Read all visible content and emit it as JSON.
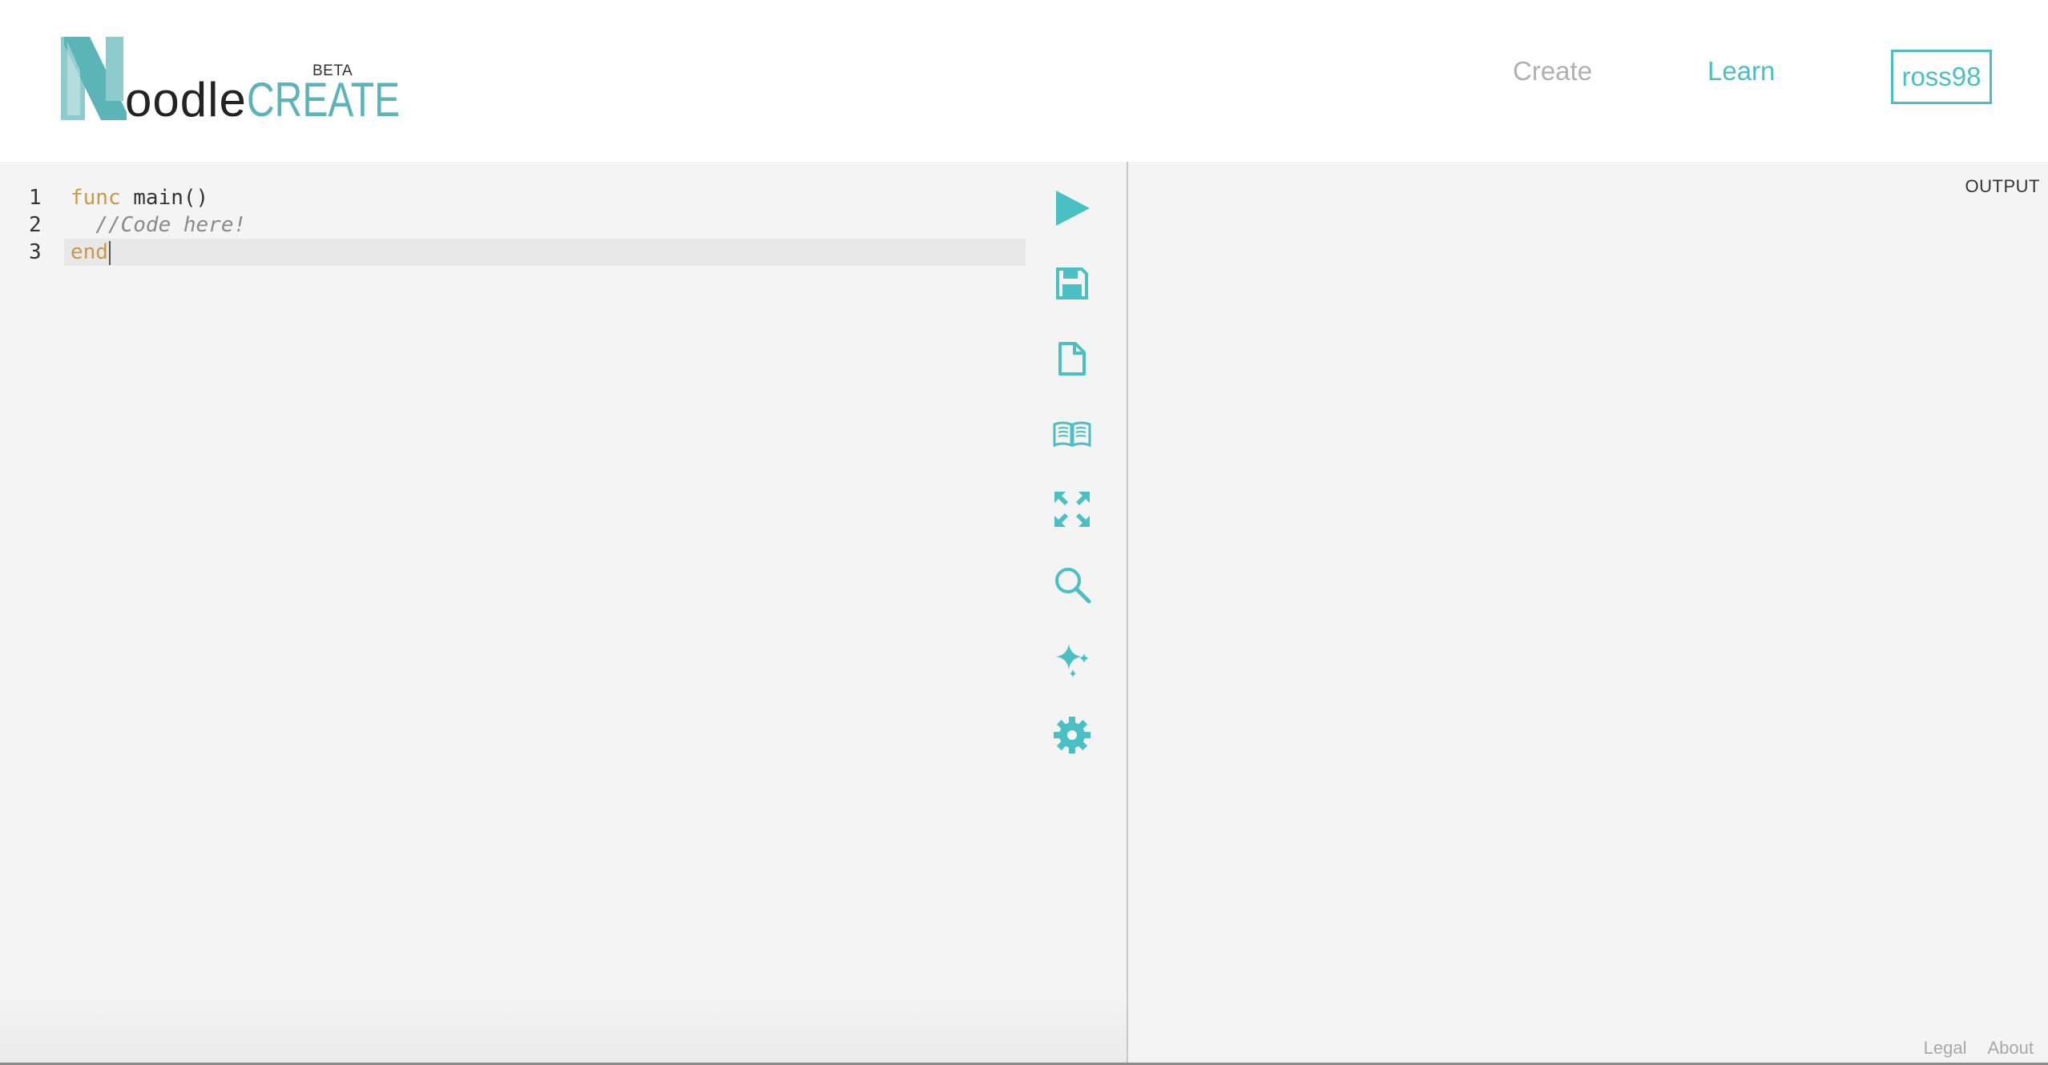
{
  "brand": {
    "prefix": "oodle",
    "suffix": "CREATE",
    "badge": "BETA"
  },
  "nav": {
    "create": "Create",
    "learn": "Learn",
    "user": "ross98"
  },
  "editor": {
    "lines": [
      {
        "number": "1",
        "keyword": "func",
        "rest": " main()"
      },
      {
        "number": "2",
        "comment": "  //Code here!"
      },
      {
        "number": "3",
        "keyword": "end"
      }
    ]
  },
  "toolbar": {
    "icons": [
      "run-icon",
      "save-icon",
      "new-file-icon",
      "docs-icon",
      "fullscreen-icon",
      "search-icon",
      "magic-icon",
      "settings-icon"
    ]
  },
  "output": {
    "label": "OUTPUT"
  },
  "footer": {
    "legal": "Legal",
    "about": "About"
  },
  "colors": {
    "accent": "#4bc0c4",
    "logo_teal": "#5bb5b8",
    "keyword": "#c7994f"
  }
}
